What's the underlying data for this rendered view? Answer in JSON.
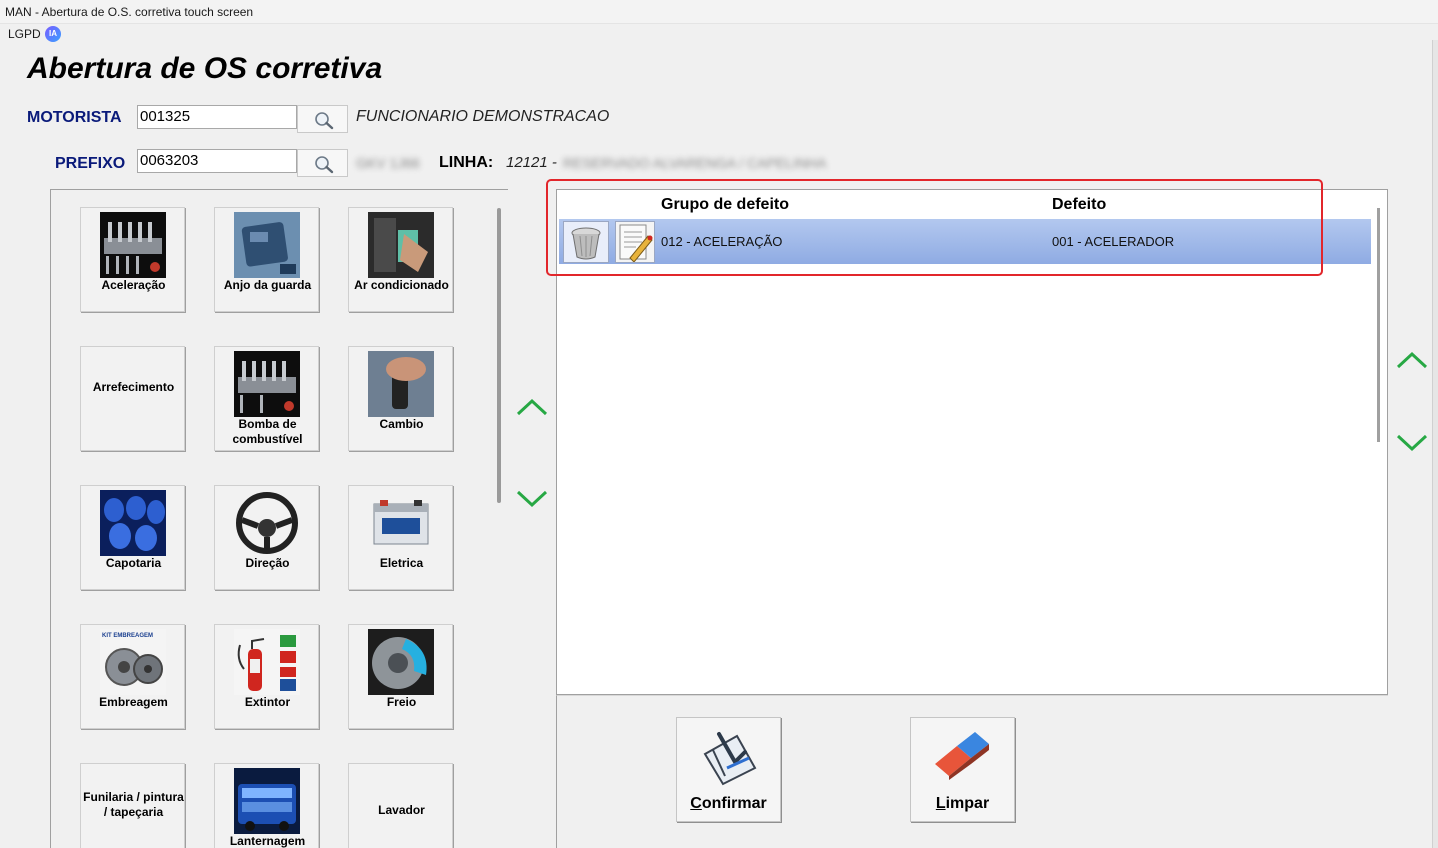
{
  "window": {
    "title": "MAN - Abertura de O.S. corretiva touch screen"
  },
  "menu": {
    "lgpd": "LGPD",
    "ia_badge": "IA"
  },
  "page": {
    "title": "Abertura de OS corretiva"
  },
  "motorista": {
    "label": "MOTORISTA",
    "code": "001325",
    "name": "FUNCIONARIO DEMONSTRACAO"
  },
  "prefixo": {
    "label": "PREFIXO",
    "code": "0063203",
    "plate_blurred": "GKV 1J66",
    "linha_label": "LINHA:",
    "linha_code": "12121 -",
    "linha_name_blurred": "RESERVADO ALVARENGA / CAPELINHA"
  },
  "categories": [
    {
      "label": "Aceleração",
      "icon": "engine-icon"
    },
    {
      "label": "Anjo da guarda",
      "icon": "device-icon"
    },
    {
      "label": "Ar condicionado",
      "icon": "air-conditioner-icon"
    },
    {
      "label": "Arrefecimento",
      "icon": ""
    },
    {
      "label": "Bomba de combustível",
      "icon": "fuel-pump-icon"
    },
    {
      "label": "Cambio",
      "icon": "gearshift-icon"
    },
    {
      "label": "Capotaria",
      "icon": "seats-icon"
    },
    {
      "label": "Direção",
      "icon": "steering-wheel-icon"
    },
    {
      "label": "Eletrica",
      "icon": "battery-icon"
    },
    {
      "label": "Embreagem",
      "icon": "clutch-icon",
      "icon_text": "KIT EMBREAGEM"
    },
    {
      "label": "Extintor",
      "icon": "extinguisher-icon"
    },
    {
      "label": "Freio",
      "icon": "brake-disc-icon"
    },
    {
      "label": "Funilaria / pintura / tapeçaria",
      "icon": ""
    },
    {
      "label": "Lanternagem",
      "icon": "bus-icon"
    },
    {
      "label": "Lavador",
      "icon": ""
    }
  ],
  "grid": {
    "columns": [
      "Grupo de defeito",
      "Defeito"
    ],
    "rows": [
      {
        "grupo": "012 - ACELERAÇÃO",
        "defeito": "001 - ACELERADOR"
      }
    ]
  },
  "buttons": {
    "confirmar": "Confirmar",
    "limpar": "Limpar"
  },
  "colors": {
    "label_blue": "#0a1a7a",
    "arrow_green": "#27a844",
    "selected_row": "#a3bbea",
    "highlight_red": "#e2262b"
  }
}
